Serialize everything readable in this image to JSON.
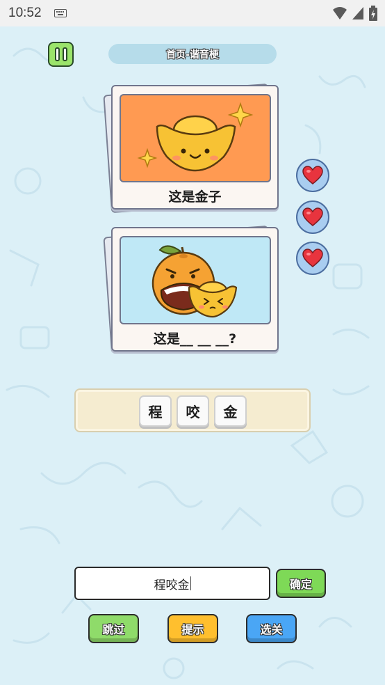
{
  "status": {
    "time": "10:52"
  },
  "header": {
    "title": "首页-谐音梗"
  },
  "cards": [
    {
      "caption": "这是金子",
      "image": "gold-ingot-image"
    },
    {
      "caption": "这是__ __ __?",
      "image": "orange-biting-gold-image"
    }
  ],
  "lives": {
    "count": 3,
    "icon": "heart-icon"
  },
  "tray": {
    "chars": [
      "程",
      "咬",
      "金"
    ]
  },
  "answer": {
    "value": "程咬金"
  },
  "buttons": {
    "confirm": "确定",
    "skip": "跳过",
    "hint": "提示",
    "levels": "选关"
  },
  "colors": {
    "background": "#dcf0f7",
    "card_top_bg": "#ff9a52",
    "card_bottom_bg": "#bfe8f6",
    "confirm": "#7ed957",
    "skip": "#8fdb6a",
    "hint": "#ffbf2e",
    "levels": "#4aa6f5",
    "heart": "#e8343e"
  }
}
